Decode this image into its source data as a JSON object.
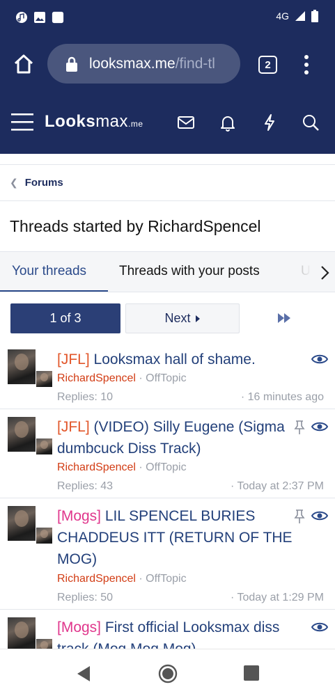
{
  "status_bar": {
    "network": "4G"
  },
  "browser": {
    "url_host": "looksmax.me",
    "url_path": "/find-tl",
    "tab_count": "2"
  },
  "app": {
    "logo_a": "Lo",
    "logo_b": "oks",
    "logo_c": "max",
    "logo_tld": ".me"
  },
  "breadcrumb": {
    "label": "Forums"
  },
  "page": {
    "title": "Threads started by RichardSpencel"
  },
  "tabs": [
    {
      "label": "Your threads"
    },
    {
      "label": "Threads with your posts"
    },
    {
      "label": "U"
    }
  ],
  "pager": {
    "current": "1 of 3",
    "next": "Next"
  },
  "threads": [
    {
      "prefix": "[JFL]",
      "title": "Looksmax hall of shame.",
      "author": "RichardSpencel",
      "forum": "OffTopic",
      "replies": "Replies: 10",
      "date": "16 minutes ago",
      "pinned": false
    },
    {
      "prefix": "[JFL]",
      "title": "(VIDEO) Silly Eugene (Sigma dumbcuck Diss Track)",
      "author": "RichardSpencel",
      "forum": "OffTopic",
      "replies": "Replies: 43",
      "date": "Today at 2:37 PM",
      "pinned": true
    },
    {
      "prefix": "[Mogs]",
      "title": "LIL SPENCEL BURIES CHADDEUS ITT (RETURN OF THE MOG)",
      "author": "RichardSpencel",
      "forum": "OffTopic",
      "replies": "Replies: 50",
      "date": "Today at 1:29 PM",
      "pinned": true
    },
    {
      "prefix": "[Mogs]",
      "title": "First official Looksmax diss track (Mog Mog Mog)",
      "author": "",
      "forum": "",
      "replies": "",
      "date": "",
      "pinned": false
    }
  ],
  "colors": {
    "brand": "#1d2c5e",
    "link": "#23407a",
    "jfl": "#e2562a",
    "mogs": "#e0368c",
    "author": "#d23c14"
  }
}
